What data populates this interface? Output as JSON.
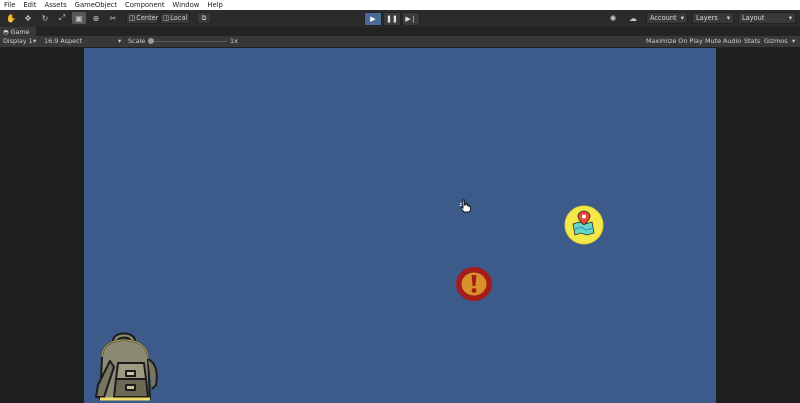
{
  "menu": [
    "File",
    "Edit",
    "Assets",
    "GameObject",
    "Component",
    "Window",
    "Help"
  ],
  "toolbar": {
    "tools": [
      "hand-tool-icon",
      "move-tool-icon",
      "rotate-tool-icon",
      "scale-tool-icon",
      "rect-tool-icon",
      "transform-tool-icon",
      "custom-tool-icon"
    ],
    "pivot_mode": "Center",
    "pivot_rotation": "Local",
    "account": "Account",
    "layers": "Layers",
    "layout": "Layout"
  },
  "game_tab": {
    "label": "Game"
  },
  "game_options": {
    "display": "Display 1",
    "aspect": "16:9 Aspect",
    "scale_label": "Scale",
    "scale_value": "1x",
    "maximize": "Maximize On Play",
    "mute": "Mute Audio",
    "stats": "Stats",
    "gizmos": "Gizmos"
  },
  "colors": {
    "viewport": "#3c5a8a",
    "play_active": "#4a6a96"
  },
  "scene_icons": [
    "map-location-icon",
    "alert-icon",
    "backpack-icon",
    "pointer-cursor-icon"
  ]
}
